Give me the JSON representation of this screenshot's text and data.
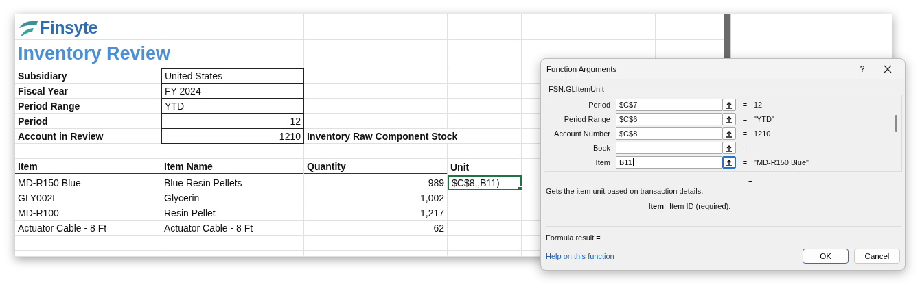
{
  "logo": {
    "text": "Finsyte"
  },
  "title": "Inventory Review",
  "parameters": [
    {
      "label": "Subsidiary",
      "value": "United States",
      "kind": "text"
    },
    {
      "label": "Fiscal Year",
      "value": "FY 2024",
      "kind": "text"
    },
    {
      "label": "Period Range",
      "value": "YTD",
      "kind": "text"
    },
    {
      "label": "Period",
      "value": "12",
      "kind": "number"
    },
    {
      "label": "Account in Review",
      "value": "1210",
      "kind": "number",
      "note": "Inventory Raw Component Stock"
    }
  ],
  "table": {
    "columns": [
      "Item",
      "Item Name",
      "Quantity",
      "Unit"
    ],
    "rows": [
      {
        "item": "MD-R150 Blue",
        "item_name": "Blue Resin Pellets",
        "quantity": "989",
        "unit": "$C$8,,B11)",
        "selected": true
      },
      {
        "item": "GLY002L",
        "item_name": "Glycerin",
        "quantity": "1,002",
        "selected": false
      },
      {
        "item": "MD-R100",
        "item_name": "Resin Pellet",
        "quantity": "1,217",
        "selected": false
      },
      {
        "item": "Actuator Cable - 8 Ft",
        "item_name": "Actuator Cable - 8 Ft",
        "quantity": "62",
        "selected": false
      }
    ]
  },
  "dialog": {
    "title": "Function Arguments",
    "help_button": "?",
    "function_name": "FSN.GLItemUnit",
    "arguments": [
      {
        "label": "Period",
        "value": "$C$7",
        "equals": "=",
        "result": "12",
        "selected": false
      },
      {
        "label": "Period Range",
        "value": "$C$6",
        "equals": "=",
        "result": "\"YTD\"",
        "selected": false
      },
      {
        "label": "Account Number",
        "value": "$C$8",
        "equals": "=",
        "result": "1210",
        "selected": false
      },
      {
        "label": "Book",
        "equals": "=",
        "selected": false
      },
      {
        "label": "Item",
        "value": "B11",
        "equals": "=",
        "result": "\"MD-R150 Blue\"",
        "selected": true
      }
    ],
    "function_equals": "=",
    "description": "Gets the item unit based on transaction details.",
    "argument_help": {
      "name": "Item",
      "text": "Item ID (required)."
    },
    "formula_result": "Formula result =",
    "help_link": "Help on this function",
    "buttons": [
      {
        "label": "OK",
        "default": true
      },
      {
        "label": "Cancel",
        "default": false
      }
    ]
  }
}
